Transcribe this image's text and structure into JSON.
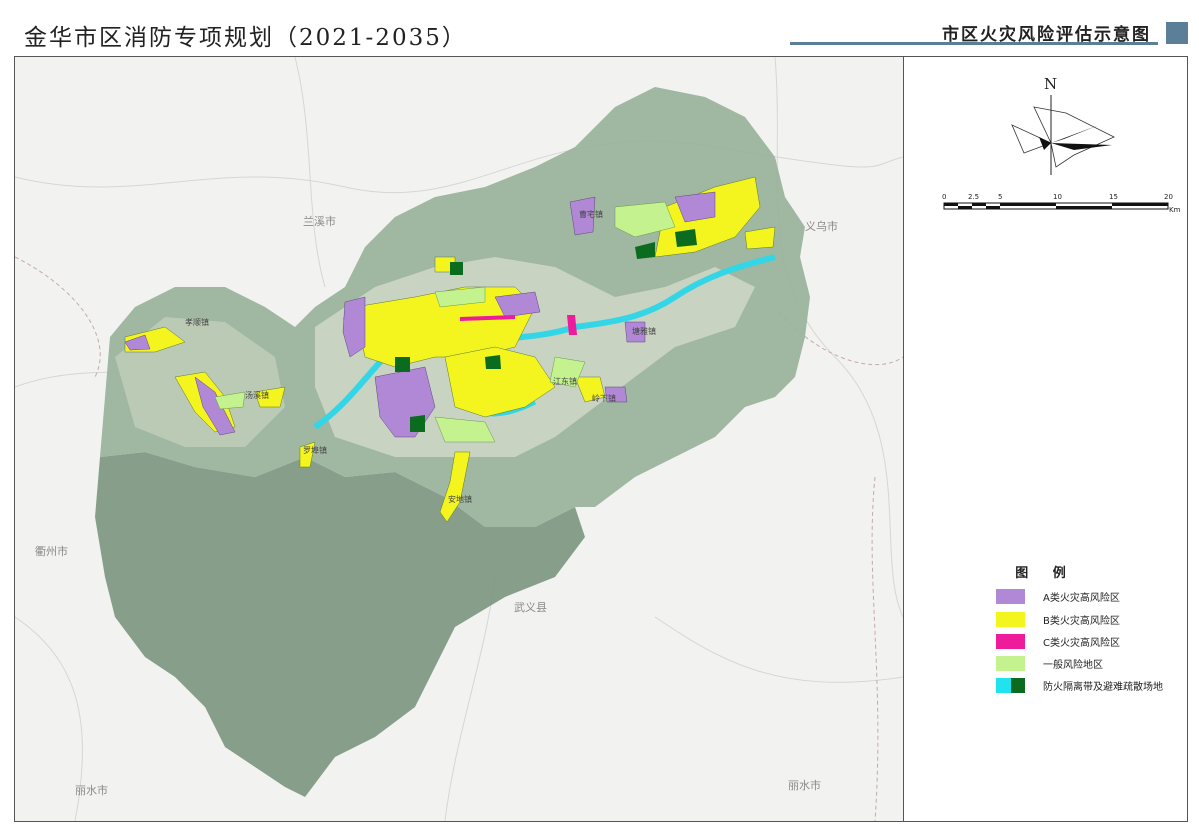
{
  "header": {
    "document_title": "金华市区消防专项规划（2021-2035）",
    "map_title": "市区火灾风险评估示意图",
    "accent_color": "#5a7f96"
  },
  "map": {
    "place_labels": {
      "lanxi": "兰溪市",
      "yiwu": "义乌市",
      "quzhou": "衢州市",
      "wuyi": "武义县",
      "lishui_left": "丽水市",
      "lishui_right": "丽水市"
    },
    "town_labels": [
      "曹宅镇",
      "孝顺镇",
      "江东镇",
      "岭下镇",
      "塘雅镇",
      "罗埠镇",
      "汤溪镇",
      "安地镇"
    ]
  },
  "north_arrow": {
    "label": "N"
  },
  "scale_bar": {
    "ticks": [
      "0",
      "2.5",
      "5",
      "10",
      "15",
      "20"
    ],
    "unit": "Km"
  },
  "legend": {
    "title": "图 例",
    "items": [
      {
        "label": "A类火灾高风险区",
        "color": "#b088d6"
      },
      {
        "label": "B类火灾高风险区",
        "color": "#f4f51e"
      },
      {
        "label": "C类火灾高风险区",
        "color": "#ee1b9a"
      },
      {
        "label": "一般风险地区",
        "color": "#c3f28e"
      },
      {
        "label": "防火隔离带及避难疏散场地",
        "colors": [
          "#1fe3ee",
          "#0b6b1f"
        ]
      }
    ]
  },
  "colors": {
    "hills": "#8fa690",
    "hills_dark": "#7b967e",
    "plain": "#cfd8c8",
    "river": "#33d6e6"
  }
}
